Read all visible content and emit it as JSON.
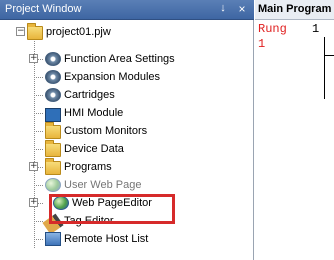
{
  "project_window": {
    "title": "Project Window",
    "pin_glyph": "↓",
    "close_glyph": "×"
  },
  "tree": {
    "root": {
      "label": "project01.pjw",
      "expander": "−"
    },
    "items": [
      {
        "label": "Function Area Settings",
        "icon": "gear-icon",
        "expander": "+"
      },
      {
        "label": "Expansion Modules",
        "icon": "gear-icon"
      },
      {
        "label": "Cartridges",
        "icon": "gear-icon"
      },
      {
        "label": "HMI Module",
        "icon": "monitor-icon"
      },
      {
        "label": "Custom Monitors",
        "icon": "folder-icon"
      },
      {
        "label": "Device Data",
        "icon": "folder-icon"
      },
      {
        "label": "Programs",
        "icon": "folder-icon",
        "expander": "+"
      },
      {
        "label": "User Web Page",
        "icon": "globe-icon"
      },
      {
        "label": "Web PageEditor",
        "icon": "globe-icon",
        "expander": "+",
        "highlighted": true
      },
      {
        "label": "Tag Editor",
        "icon": "pencil-icon"
      },
      {
        "label": "Remote Host List",
        "icon": "server-icon"
      }
    ]
  },
  "main_program": {
    "tab_title": "Main Program",
    "rung_label": "Rung",
    "rung_number": "1",
    "rung_index": "1"
  },
  "colors": {
    "highlight_border": "#d62a2a",
    "rung_text": "#e02020",
    "titlebar": "#4a72ad"
  }
}
